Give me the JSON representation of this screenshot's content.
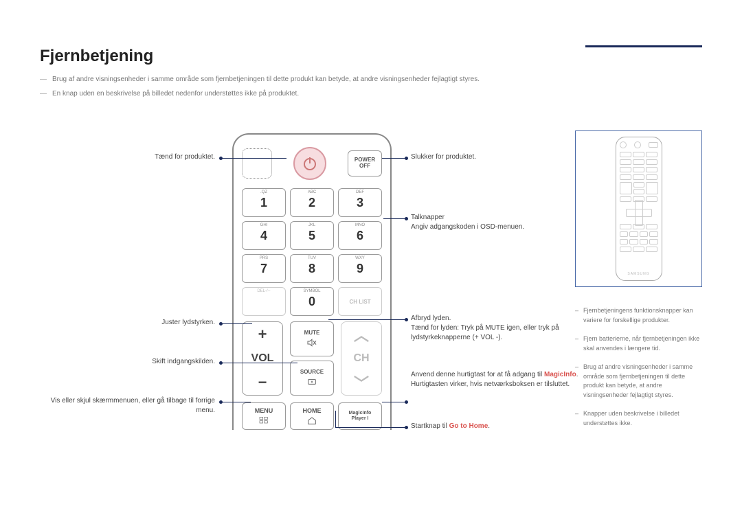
{
  "title": "Fjernbetjening",
  "header_notes": [
    "Brug af andre visningsenheder i samme område som fjernbetjeningen til dette produkt kan betyde, at andre visningsenheder fejlagtigt styres.",
    "En knap uden en beskrivelse på billedet nedenfor understøttes ikke på produktet."
  ],
  "remote": {
    "power_off_top": "POWER",
    "power_off_bot": "OFF",
    "keys": [
      {
        "top": ".QZ",
        "digit": "1"
      },
      {
        "top": "ABC",
        "digit": "2"
      },
      {
        "top": "DEF",
        "digit": "3"
      },
      {
        "top": "GHI",
        "digit": "4"
      },
      {
        "top": "JKL",
        "digit": "5"
      },
      {
        "top": "MNO",
        "digit": "6"
      },
      {
        "top": "PRS",
        "digit": "7"
      },
      {
        "top": "TUV",
        "digit": "8"
      },
      {
        "top": "WXY",
        "digit": "9"
      },
      {
        "top": "DEL-/--",
        "digit": ""
      },
      {
        "top": "SYMBOL",
        "digit": "0"
      },
      {
        "top": "",
        "digit": "CH LIST"
      }
    ],
    "vol_plus": "+",
    "vol_label": "VOL",
    "vol_minus": "−",
    "mute": "MUTE",
    "source": "SOURCE",
    "ch_up": "︿",
    "ch_label": "CH",
    "ch_dn": "﹀",
    "menu": "MENU",
    "home": "HOME",
    "magicinfo_top": "MagicInfo",
    "magicinfo_bot": "Player I"
  },
  "callouts": {
    "power_on": "Tænd for produktet.",
    "power_off": "Slukker for produktet.",
    "numbers_1": "Talknapper",
    "numbers_2": "Angiv adgangskoden i OSD-menuen.",
    "vol": "Juster lydstyrken.",
    "source": "Skift indgangskilden.",
    "menu": "Vis eller skjul skærmmenuen, eller gå tilbage til forrige menu.",
    "mute_1": "Afbryd lyden.",
    "mute_2": "Tænd for lyden: Tryk på MUTE igen, eller tryk på lydstyrkeknapperne (+ VOL -).",
    "magicinfo_1": "Anvend denne hurtigtast for at få adgang til ",
    "magicinfo_red": "MagicInfo",
    "magicinfo_2": "Hurtigtasten virker, hvis netværksboksen er tilsluttet.",
    "home_1": "Startknap til ",
    "home_red": "Go to Home"
  },
  "side_notes": [
    "Fjernbetjeningens funktionsknapper kan variere for forskellige produkter.",
    "Fjern batterierne, når fjernbetjeningen ikke skal anvendes i længere tid.",
    "Brug af andre visningsenheder i samme område som fjernbetjeningen til dette produkt kan betyde, at andre visningsenheder fejlagtigt styres.",
    "Knapper uden beskrivelse i billedet understøttes ikke."
  ],
  "mini_brand": "SAMSUNG"
}
